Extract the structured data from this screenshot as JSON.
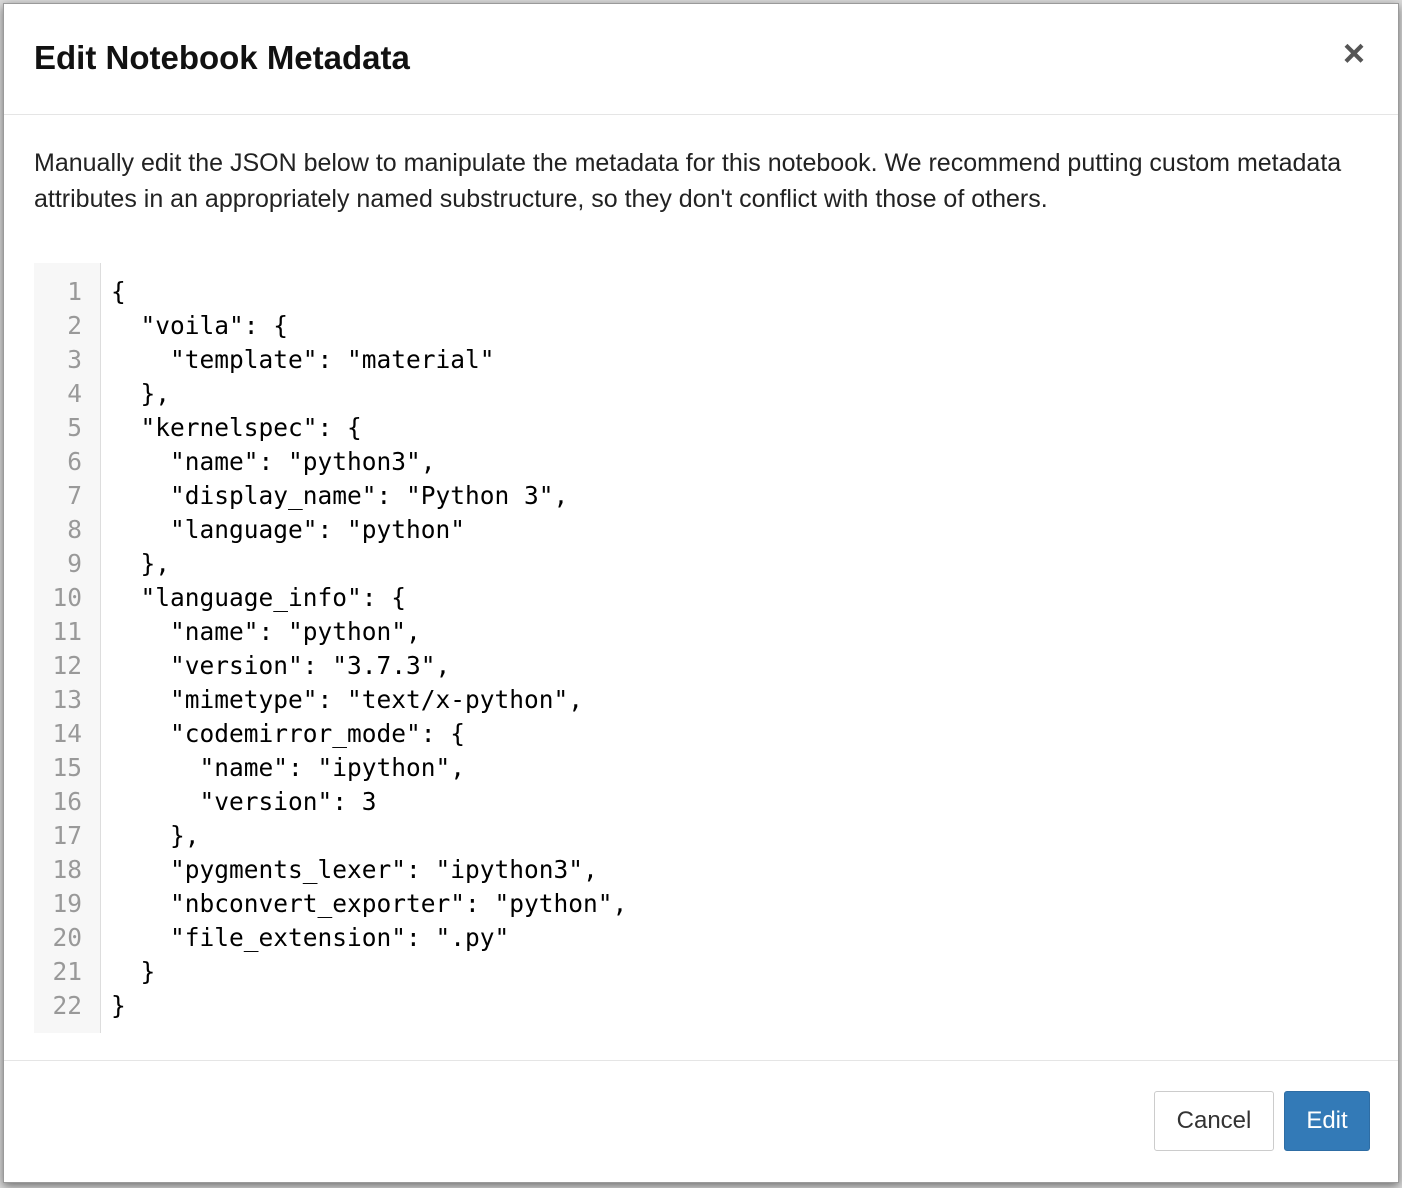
{
  "dialog": {
    "title": "Edit Notebook Metadata",
    "close_symbol": "×",
    "description": "Manually edit the JSON below to manipulate the metadata for this notebook. We recommend putting custom metadata attributes in an appropriately named substructure, so they don't conflict with those of others."
  },
  "editor": {
    "line_numbers": [
      "1",
      "2",
      "3",
      "4",
      "5",
      "6",
      "7",
      "8",
      "9",
      "10",
      "11",
      "12",
      "13",
      "14",
      "15",
      "16",
      "17",
      "18",
      "19",
      "20",
      "21",
      "22"
    ],
    "lines": [
      "{",
      "  \"voila\": {",
      "    \"template\": \"material\"",
      "  },",
      "  \"kernelspec\": {",
      "    \"name\": \"python3\",",
      "    \"display_name\": \"Python 3\",",
      "    \"language\": \"python\"",
      "  },",
      "  \"language_info\": {",
      "    \"name\": \"python\",",
      "    \"version\": \"3.7.3\",",
      "    \"mimetype\": \"text/x-python\",",
      "    \"codemirror_mode\": {",
      "      \"name\": \"ipython\",",
      "      \"version\": 3",
      "    },",
      "    \"pygments_lexer\": \"ipython3\",",
      "    \"nbconvert_exporter\": \"python\",",
      "    \"file_extension\": \".py\"",
      "  }",
      "}"
    ]
  },
  "footer": {
    "cancel_label": "Cancel",
    "edit_label": "Edit"
  },
  "colors": {
    "primary": "#337ab7",
    "gutter_bg": "#f7f7f7",
    "line_number": "#999999"
  },
  "icons": {
    "close": "close-icon"
  }
}
